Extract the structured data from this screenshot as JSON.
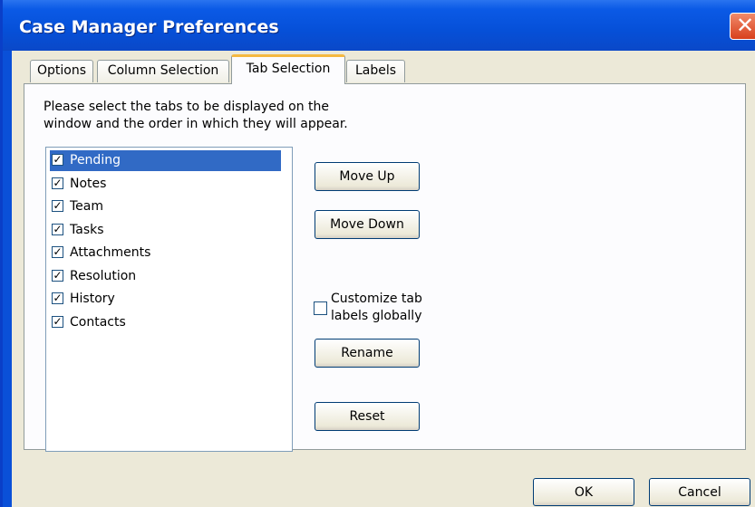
{
  "window": {
    "title": "Case Manager Preferences",
    "close_symbol": "✕"
  },
  "tabs": [
    {
      "label": "Options",
      "active": false
    },
    {
      "label": "Column Selection",
      "active": false
    },
    {
      "label": "Tab Selection",
      "active": true
    },
    {
      "label": "Labels",
      "active": false
    }
  ],
  "panel": {
    "instructions_line1": "Please select the tabs to be displayed on the",
    "instructions_line2": "window and the order in which they will appear.",
    "items": [
      {
        "label": "Pending",
        "checked": true,
        "selected": true
      },
      {
        "label": "Notes",
        "checked": true,
        "selected": false
      },
      {
        "label": "Team",
        "checked": true,
        "selected": false
      },
      {
        "label": "Tasks",
        "checked": true,
        "selected": false
      },
      {
        "label": "Attachments",
        "checked": true,
        "selected": false
      },
      {
        "label": "Resolution",
        "checked": true,
        "selected": false
      },
      {
        "label": "History",
        "checked": true,
        "selected": false
      },
      {
        "label": "Contacts",
        "checked": true,
        "selected": false
      }
    ],
    "check_mark": "✓",
    "move_up_label": "Move Up",
    "move_down_label": "Move Down",
    "customize_line1": "Customize tab",
    "customize_line2": "labels globally",
    "customize_checked": false,
    "rename_label": "Rename",
    "reset_label": "Reset"
  },
  "footer": {
    "ok_label": "OK",
    "cancel_label": "Cancel"
  },
  "colors": {
    "title_bar": "#0650d8",
    "selection": "#316ac5",
    "active_tab_accent": "#f5b941",
    "dialog_face": "#ece9d8"
  }
}
